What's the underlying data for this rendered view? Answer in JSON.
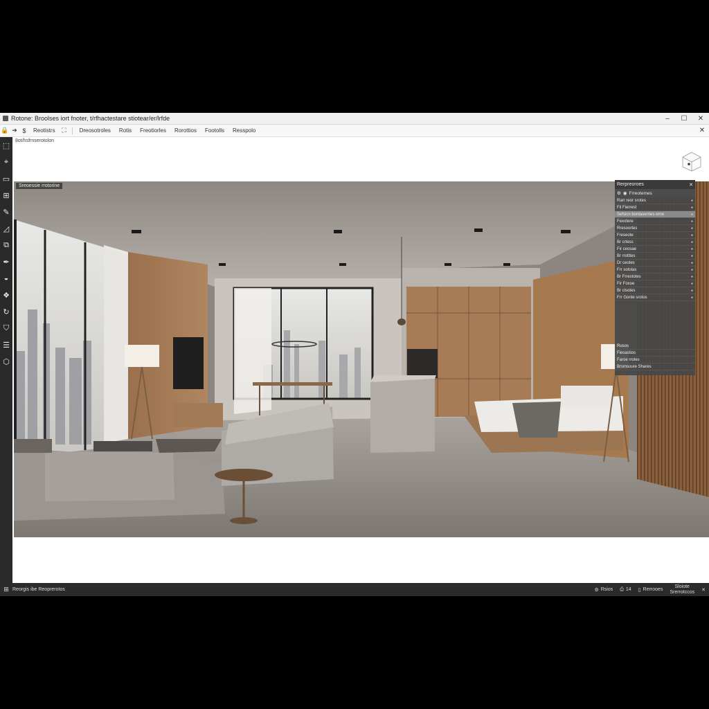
{
  "window": {
    "title": "Rotone: Broolses iort fnoter, t/rfhactestare stiotear/er/lrfde",
    "controls": {
      "minimize": "–",
      "maximize": "☐",
      "close": "✕"
    }
  },
  "toolbar": {
    "icons": [
      "lock-icon",
      "arrow-right-icon",
      "dollar-icon",
      "snapshot-icon"
    ],
    "icon_glyphs": [
      "🔒",
      "➔",
      "$",
      "⛶"
    ],
    "tab_label": "Reotistrs",
    "items": [
      "Dreosotroles",
      "Rotis",
      "Freotiorles",
      "Rorottios",
      "Footolls",
      "Resspolo"
    ],
    "close": "✕"
  },
  "path": "8ot/hsfrnserotolon",
  "viewport": {
    "label": "Sreoessie rrotorine"
  },
  "tools": [
    {
      "name": "select-tool-icon",
      "glyph": "⬚"
    },
    {
      "name": "dimension-tool-icon",
      "glyph": "⌖"
    },
    {
      "name": "rectangle-tool-icon",
      "glyph": "▭"
    },
    {
      "name": "grid-tool-icon",
      "glyph": "⊞"
    },
    {
      "name": "brush-tool-icon",
      "glyph": "✎"
    },
    {
      "name": "shape-tool-icon",
      "glyph": "◿"
    },
    {
      "name": "nodes-tool-icon",
      "glyph": "⧉"
    },
    {
      "name": "pen-tool-icon",
      "glyph": "✒"
    },
    {
      "name": "fill-tool-icon",
      "glyph": "◒"
    },
    {
      "name": "group-tool-icon",
      "glyph": "❖"
    },
    {
      "name": "rotate-tool-icon",
      "glyph": "↻"
    },
    {
      "name": "shield-tool-icon",
      "glyph": "⛉"
    },
    {
      "name": "layers-tool-icon",
      "glyph": "☰"
    },
    {
      "name": "tag-tool-icon",
      "glyph": "⬡"
    }
  ],
  "properties": {
    "title": "Rerpreoroes",
    "close": "✕",
    "subheader": "Frreotemes",
    "rows": [
      {
        "label": "Rarr reor srotes",
        "highlight": false
      },
      {
        "label": "Fil  Fierrest",
        "highlight": false
      },
      {
        "label": "Sefsicn bontaserries orne",
        "highlight": true
      },
      {
        "label": "Fexotere",
        "highlight": false
      },
      {
        "label": "Rresoortes",
        "highlight": false
      },
      {
        "label": "Freseote",
        "highlight": false
      },
      {
        "label": "Br crtess",
        "highlight": false
      },
      {
        "label": "Fir ceosae",
        "highlight": false
      },
      {
        "label": "Br rrotttes",
        "highlight": false
      },
      {
        "label": "Dr ceotes",
        "highlight": false
      },
      {
        "label": "Frr sotolas",
        "highlight": false
      },
      {
        "label": "Br Frrestotes",
        "highlight": false
      },
      {
        "label": "Fir Foxoe",
        "highlight": false
      },
      {
        "label": "Br clsotes",
        "highlight": false
      },
      {
        "label": "Frr Gonte srotos",
        "highlight": false
      }
    ],
    "footer": [
      "Rusos",
      "Fiesastios",
      "Faroe rrotes",
      "Brsmsoure Shares"
    ]
  },
  "statusbar": {
    "left": "Reorgis ibe Reoprerotos",
    "items": [
      {
        "icon": "settings-icon",
        "glyph": "⚙",
        "label": "Rsios"
      },
      {
        "icon": "printer-icon",
        "glyph": "⎙",
        "label": "14"
      },
      {
        "icon": "frame-icon",
        "glyph": "▯",
        "label": "Rerrooes"
      }
    ],
    "stack_top": "Sloiote",
    "stack_bottom": "Srerrotccos",
    "close": "✕"
  },
  "colors": {
    "toolstrip": "#2a2a2a",
    "statusbar": "#2b2b2b",
    "panel": "#464646",
    "panel_highlight": "#8a8a8a"
  }
}
